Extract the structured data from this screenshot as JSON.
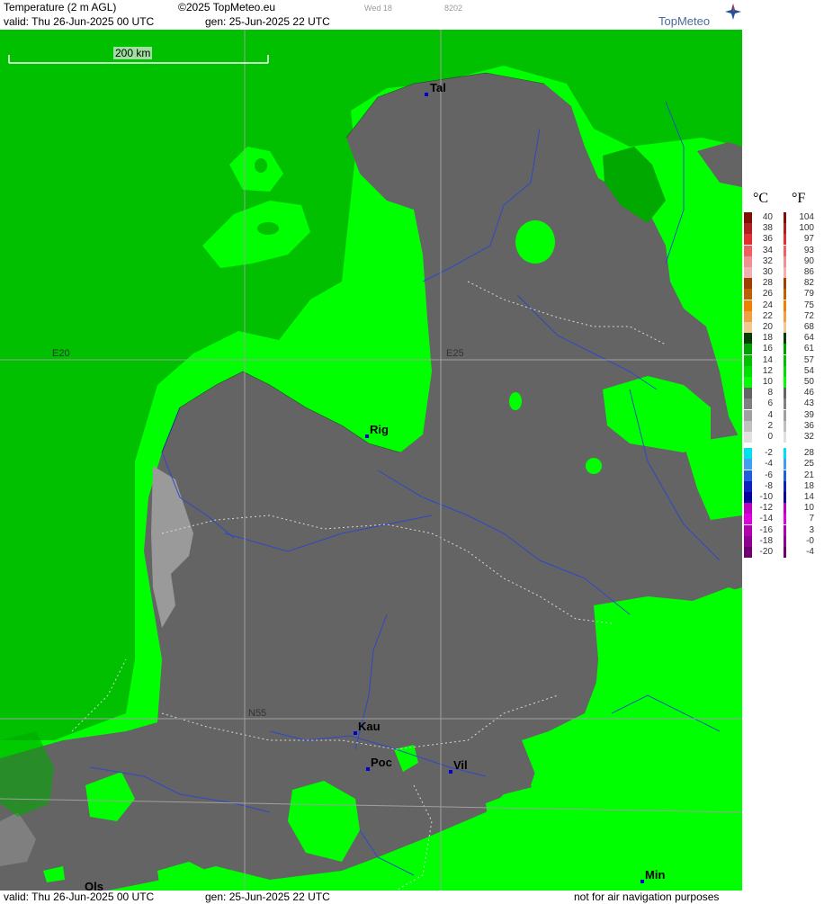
{
  "header": {
    "title": "Temperature (2 m AGL)",
    "copyright": "©2025 TopMeteo.eu",
    "faint_day": "Wed 18",
    "faint_code": "8202",
    "valid": "valid:  Thu  26-Jun-2025  00 UTC",
    "gen": "gen:  25-Jun-2025  22 UTC",
    "brand": "TopMeteo"
  },
  "footer": {
    "valid": "valid:  Thu  26-Jun-2025  00 UTC",
    "gen": "gen:  25-Jun-2025  22 UTC",
    "note": "not for air navigation purposes"
  },
  "map": {
    "scale_label": "200 km",
    "grid_labels": {
      "lon_e20": "E20",
      "lon_e25": "E25",
      "lat_n55": "N55"
    },
    "cities": {
      "tal": "Tal",
      "rig": "Rig",
      "kau": "Kau",
      "poc": "Poc",
      "vil": "Vil",
      "min": "Min",
      "ols": "Ols"
    },
    "colors": {
      "warm_green": "#00c000",
      "bright_green": "#00ff00",
      "grey_cool": "#646464",
      "grey_light": "#9a9a9a",
      "dark_green": "#00a800"
    }
  },
  "legend": {
    "unit_c": "°C",
    "unit_f": "°F",
    "celsius": [
      "40",
      "38",
      "36",
      "34",
      "32",
      "30",
      "28",
      "26",
      "24",
      "22",
      "20",
      "18",
      "16",
      "14",
      "12",
      "10",
      "8",
      "6",
      "4",
      "2",
      "0",
      "-2",
      "-4",
      "-6",
      "-8",
      "-10",
      "-12",
      "-14",
      "-16",
      "-18",
      "-20"
    ],
    "fahrenheit": [
      "104",
      "100",
      "97",
      "93",
      "90",
      "86",
      "82",
      "79",
      "75",
      "72",
      "68",
      "64",
      "61",
      "57",
      "54",
      "50",
      "46",
      "43",
      "39",
      "36",
      "32",
      "28",
      "25",
      "21",
      "18",
      "14",
      "10",
      "7",
      "3",
      "-0",
      "-4"
    ],
    "colors": [
      "#801000",
      "#b02020",
      "#e03030",
      "#f06060",
      "#f09090",
      "#f0b0b0",
      "#a04000",
      "#c06000",
      "#f08000",
      "#f0a040",
      "#f0c890",
      "#004000",
      "#00a000",
      "#00c000",
      "#00e000",
      "#00ff00",
      "#646464",
      "#808080",
      "#a0a0a0",
      "#c0c0c0",
      "#e0e0e0",
      "#00e0f0",
      "#40a0f0",
      "#2060e0",
      "#1020c0",
      "#0000a0",
      "#c000c0",
      "#e000e0",
      "#b000b0",
      "#900090",
      "#700070"
    ]
  }
}
